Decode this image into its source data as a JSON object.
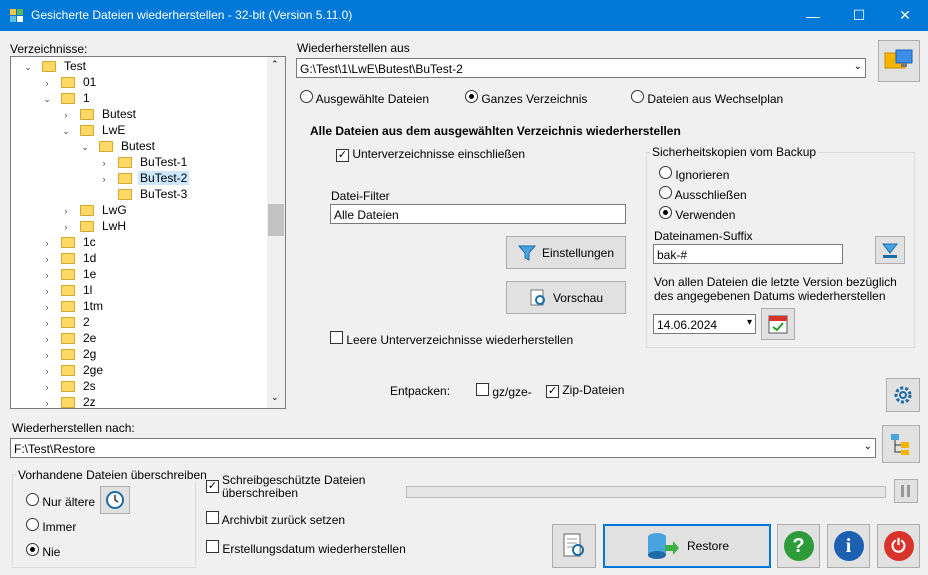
{
  "window": {
    "title": "Gesicherte Dateien wiederherstellen - 32-bit (Version 5.11.0)",
    "minimize": "—",
    "maximize": "☐",
    "close": "✕"
  },
  "left": {
    "label": "Verzeichnisse:"
  },
  "tree": [
    {
      "label": "Test",
      "depth": 1,
      "expander": "⌄",
      "selected": false
    },
    {
      "label": "01",
      "depth": 2,
      "expander": "›",
      "selected": false
    },
    {
      "label": "1",
      "depth": 2,
      "expander": "⌄",
      "selected": false
    },
    {
      "label": "Butest",
      "depth": 3,
      "expander": "›",
      "selected": false
    },
    {
      "label": "LwE",
      "depth": 3,
      "expander": "⌄",
      "selected": false
    },
    {
      "label": "Butest",
      "depth": 4,
      "expander": "⌄",
      "selected": false
    },
    {
      "label": "BuTest-1",
      "depth": 5,
      "expander": "›",
      "selected": false
    },
    {
      "label": "BuTest-2",
      "depth": 5,
      "expander": "›",
      "selected": true
    },
    {
      "label": "BuTest-3",
      "depth": 5,
      "expander": "",
      "selected": false
    },
    {
      "label": "LwG",
      "depth": 3,
      "expander": "›",
      "selected": false
    },
    {
      "label": "LwH",
      "depth": 3,
      "expander": "›",
      "selected": false
    },
    {
      "label": "1c",
      "depth": 2,
      "expander": "›",
      "selected": false
    },
    {
      "label": "1d",
      "depth": 2,
      "expander": "›",
      "selected": false
    },
    {
      "label": "1e",
      "depth": 2,
      "expander": "›",
      "selected": false
    },
    {
      "label": "1l",
      "depth": 2,
      "expander": "›",
      "selected": false
    },
    {
      "label": "1tm",
      "depth": 2,
      "expander": "›",
      "selected": false
    },
    {
      "label": "2",
      "depth": 2,
      "expander": "›",
      "selected": false
    },
    {
      "label": "2e",
      "depth": 2,
      "expander": "›",
      "selected": false
    },
    {
      "label": "2g",
      "depth": 2,
      "expander": "›",
      "selected": false
    },
    {
      "label": "2ge",
      "depth": 2,
      "expander": "›",
      "selected": false
    },
    {
      "label": "2s",
      "depth": 2,
      "expander": "›",
      "selected": false
    },
    {
      "label": "2z",
      "depth": 2,
      "expander": "›",
      "selected": false
    }
  ],
  "restore_from": {
    "label": "Wiederherstellen aus",
    "path": "G:\\Test\\1\\LwE\\Butest\\BuTest-2"
  },
  "mode": {
    "selected_files": "Ausgewählte Dateien",
    "whole_dir": "Ganzes Verzeichnis",
    "removable": "Dateien aus Wechselplan",
    "selected": "whole_dir"
  },
  "heading": "Alle Dateien aus dem ausgewählten Verzeichnis wiederherstellen",
  "include_subdirs": "Unterverzeichnisse einschließen",
  "filter": {
    "label": "Datei-Filter",
    "value": "Alle Dateien"
  },
  "settings_button": "Einstellungen",
  "preview_button": "Vorschau",
  "empty_subdirs": "Leere Unterverzeichnisse wiederherstellen",
  "backup_copies": {
    "title": "Sicherheitskopien vom Backup",
    "ignore": "Ignorieren",
    "exclude": "Ausschließen",
    "use": "Verwenden",
    "selected": "use",
    "suffix_label": "Dateinamen-Suffix",
    "suffix_value": "bak-#",
    "date_note": "Von allen Dateien die letzte Version bezüglich des angegebenen Datums wiederherstellen",
    "date": "14.06.2024"
  },
  "unpack": {
    "label": "Entpacken:",
    "gz": "gz/gze-",
    "zip": "Zip-Dateien",
    "gz_checked": false,
    "zip_checked": true
  },
  "restore_to": {
    "label": "Wiederherstellen nach:",
    "path": "F:\\Test\\Restore"
  },
  "overwrite": {
    "title": "Vorhandene Dateien überschreiben",
    "older": "Nur ältere",
    "always": "Immer",
    "never": "Nie",
    "selected": "never"
  },
  "options": {
    "readonly": "Schreibgeschützte Dateien überschreiben",
    "archive": "Archivbit zurück setzen",
    "creation": "Erstellungsdatum wiederherstellen",
    "readonly_checked": true
  },
  "restore_button": "Restore",
  "icons": {
    "check": "✓",
    "calendar_dd": "▾",
    "dropdown": "⌄",
    "help": "?",
    "info": "i",
    "power": "⏻"
  }
}
